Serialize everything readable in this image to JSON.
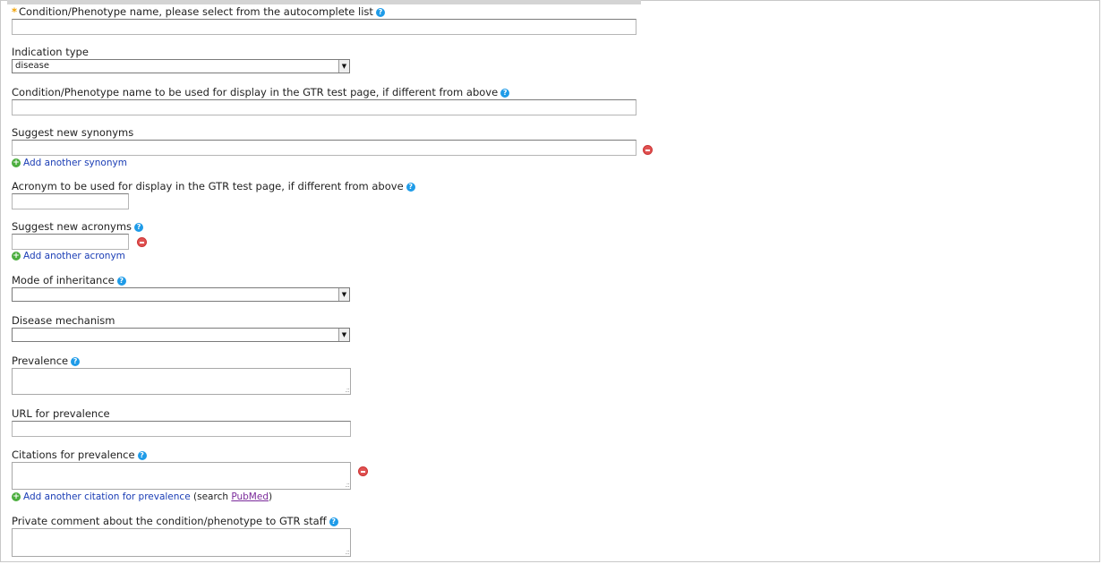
{
  "fields": {
    "condition_name": {
      "label": "Condition/Phenotype name, please select from the autocomplete list",
      "required_mark": "*",
      "value": ""
    },
    "indication_type": {
      "label": "Indication type",
      "selected": "disease"
    },
    "display_name": {
      "label": "Condition/Phenotype name to be used for display in the GTR test page, if different from above",
      "value": ""
    },
    "synonyms": {
      "label": "Suggest new synonyms",
      "value": "",
      "add_label": "Add another synonym"
    },
    "acronym_display": {
      "label": "Acronym to be used for display in the GTR test page, if different from above",
      "value": ""
    },
    "acronyms": {
      "label": "Suggest new acronyms",
      "value": "",
      "add_label": "Add another acronym"
    },
    "inheritance": {
      "label": "Mode of inheritance",
      "selected": ""
    },
    "mechanism": {
      "label": "Disease mechanism",
      "selected": ""
    },
    "prevalence": {
      "label": "Prevalence",
      "value": ""
    },
    "prevalence_url": {
      "label": "URL for prevalence",
      "value": ""
    },
    "prevalence_citations": {
      "label": "Citations for prevalence",
      "value": "",
      "add_label": "Add another citation for prevalence",
      "search_prefix": "(search ",
      "search_link": "PubMed",
      "search_suffix": ")"
    },
    "private_comment": {
      "label": "Private comment about the condition/phenotype to GTR staff",
      "value": ""
    }
  },
  "icons": {
    "help": "question-circle-icon",
    "add": "plus-circle-icon",
    "remove": "minus-circle-icon",
    "dropdown": "chevron-down-icon"
  },
  "colors": {
    "help_icon": "#1e9be8",
    "add_icon": "#4cae3f",
    "remove_icon": "#e05252",
    "required_star": "#f0a000",
    "link": "#1a3db5",
    "visited_link": "#7a2a9a"
  }
}
